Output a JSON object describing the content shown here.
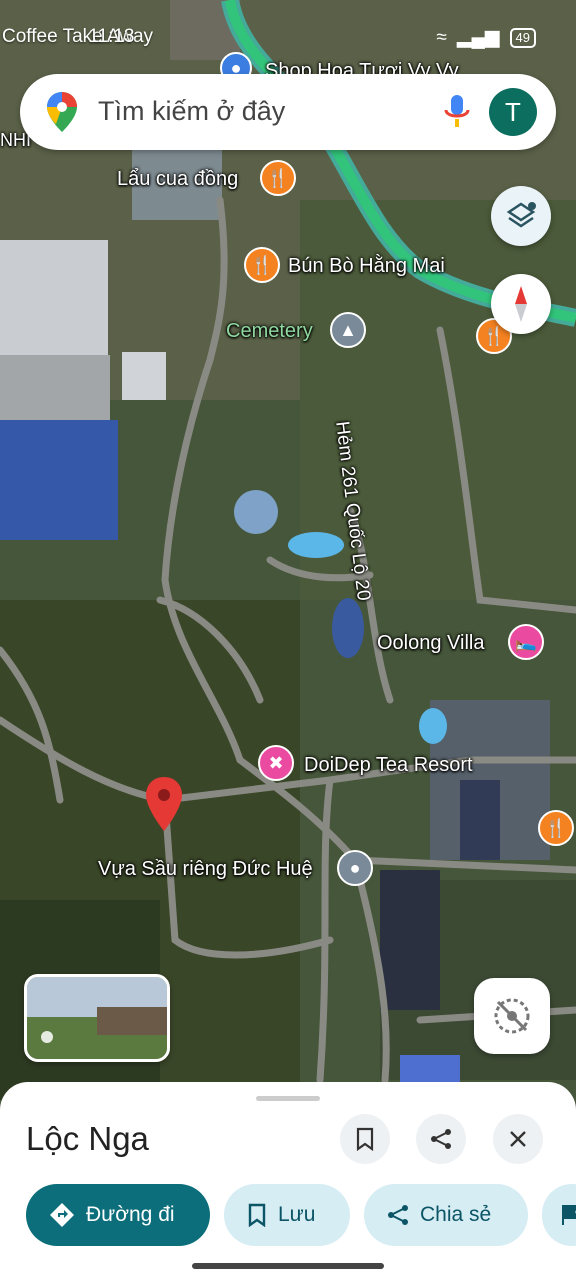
{
  "status": {
    "left_text": "Coffee Take Away",
    "time": "11:13",
    "battery": "49"
  },
  "search": {
    "placeholder": "Tìm kiếm ở đây",
    "avatar_letter": "T"
  },
  "map_labels": {
    "shop_top": "Shop Hoa Tươi Vy Vy",
    "lau_cua": "Lẩu cua đồng",
    "bun_bo": "Bún Bò Hằng Mai",
    "cemetery": "Cemetery",
    "road": "Hẻm 261 Quốc Lộ 20",
    "oolong": "Oolong Villa",
    "doidep": "DoiDep Tea Resort",
    "vua_sau": "Vựa Sầu riêng Đức Huệ",
    "nhi": "NHI"
  },
  "place": {
    "title": "Lộc Nga"
  },
  "actions": {
    "directions": "Đường đi",
    "save": "Lưu",
    "share": "Chia sẻ"
  },
  "colors": {
    "primary": "#0b6e7a",
    "chip_bg": "#d6edf4",
    "pin": "#e53935"
  }
}
